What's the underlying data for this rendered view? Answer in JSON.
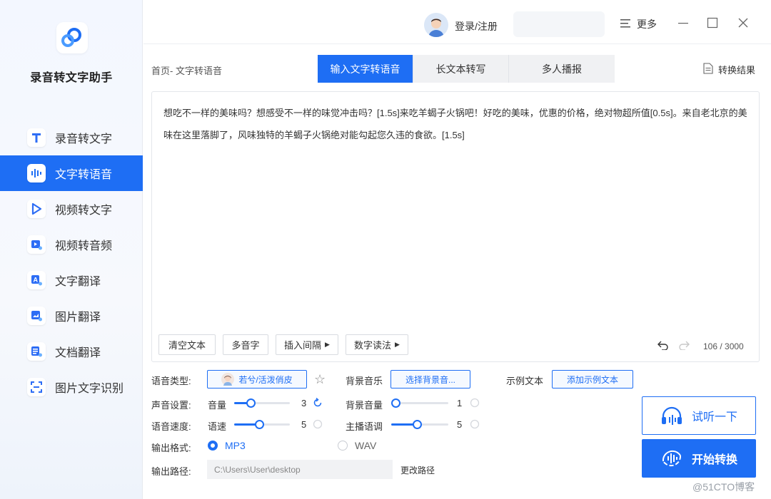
{
  "app": {
    "name": "录音转文字助手"
  },
  "sidebar": {
    "items": [
      {
        "label": "录音转文字",
        "icon": "text-t-icon"
      },
      {
        "label": "文字转语音",
        "icon": "soundwave-icon"
      },
      {
        "label": "视频转文字",
        "icon": "video-play-icon"
      },
      {
        "label": "视频转音频",
        "icon": "video-audio-icon"
      },
      {
        "label": "文字翻译",
        "icon": "text-translate-icon"
      },
      {
        "label": "图片翻译",
        "icon": "image-translate-icon"
      },
      {
        "label": "文档翻译",
        "icon": "doc-translate-icon"
      },
      {
        "label": "图片文字识别",
        "icon": "scan-icon"
      }
    ],
    "active_index": 1
  },
  "header": {
    "login_label": "登录/注册",
    "more_label": "更多"
  },
  "breadcrumb": "首页- 文字转语音",
  "tabs": [
    {
      "label": "输入文字转语音"
    },
    {
      "label": "长文本转写"
    },
    {
      "label": "多人播报"
    }
  ],
  "result_label": "转换结果",
  "editor": {
    "text": "想吃不一样的美味吗？想感受不一样的味觉冲击吗？[1.5s]来吃羊蝎子火锅吧！好吃的美味，优惠的价格，绝对物超所值[0.5s]。来自老北京的美味在这里落脚了，风味独特的羊蝎子火锅绝对能勾起您久违的食欲。[1.5s]",
    "clear_label": "清空文本",
    "polyphone_label": "多音字",
    "insert_pause_label": "插入间隔",
    "number_read_label": "数字读法",
    "counter": "106 / 3000"
  },
  "settings": {
    "voice_type_label": "语音类型:",
    "voice_name": "若兮/活泼俏皮",
    "bgm_label": "背景音乐",
    "bgm_button": "选择背景音...",
    "sample_label": "示例文本",
    "sample_button": "添加示例文本",
    "sound_label": "声音设置:",
    "volume_label": "音量",
    "volume_value": "3",
    "volume_fraction": 0.3,
    "bgm_volume_label": "背景音量",
    "bgm_volume_value": "1",
    "bgm_volume_fraction": 0.0,
    "speed_row_label": "语音速度:",
    "speed_label": "语速",
    "speed_value": "5",
    "speed_fraction": 0.45,
    "pitch_label": "主播语调",
    "pitch_value": "5",
    "pitch_fraction": 0.45,
    "format_label": "输出格式:",
    "format_mp3": "MP3",
    "format_wav": "WAV",
    "path_label": "输出路径:",
    "path_value": "C:\\Users\\User\\desktop",
    "change_path_label": "更改路径"
  },
  "actions": {
    "listen_label": "试听一下",
    "convert_label": "开始转换"
  },
  "watermark": "@51CTO博客",
  "colors": {
    "accent": "#1e6ef4"
  }
}
